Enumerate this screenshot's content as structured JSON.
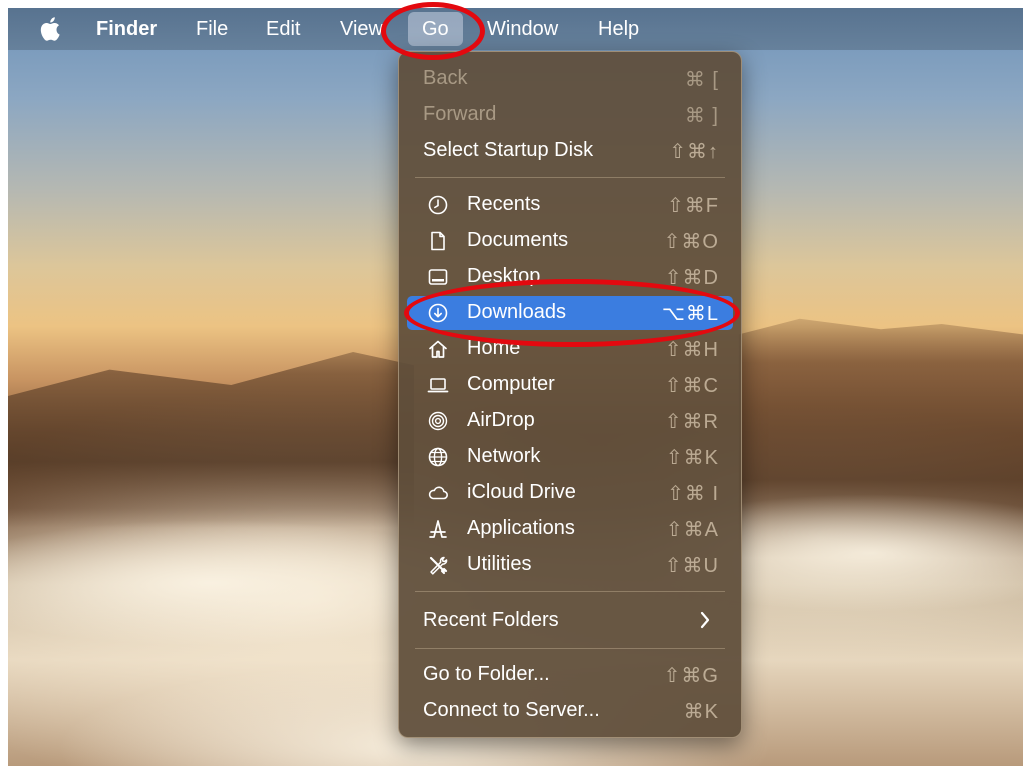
{
  "menubar": {
    "app_name": "Finder",
    "items": [
      "File",
      "Edit",
      "View",
      "Go",
      "Window",
      "Help"
    ]
  },
  "go_menu": {
    "items": [
      {
        "label": "Back",
        "shortcut": "⌘ [",
        "disabled": true
      },
      {
        "label": "Forward",
        "shortcut": "⌘ ]",
        "disabled": true
      },
      {
        "label": "Select Startup Disk",
        "shortcut": "⇧⌘↑"
      },
      {
        "label": "Recents",
        "shortcut": "⇧⌘F",
        "icon": "clock-icon"
      },
      {
        "label": "Documents",
        "shortcut": "⇧⌘O",
        "icon": "document-icon"
      },
      {
        "label": "Desktop",
        "shortcut": "⇧⌘D",
        "icon": "desktop-icon"
      },
      {
        "label": "Downloads",
        "shortcut": "⌥⌘L",
        "icon": "download-icon",
        "highlighted": true
      },
      {
        "label": "Home",
        "shortcut": "⇧⌘H",
        "icon": "home-icon"
      },
      {
        "label": "Computer",
        "shortcut": "⇧⌘C",
        "icon": "laptop-icon"
      },
      {
        "label": "AirDrop",
        "shortcut": "⇧⌘R",
        "icon": "airdrop-icon"
      },
      {
        "label": "Network",
        "shortcut": "⇧⌘K",
        "icon": "globe-icon"
      },
      {
        "label": "iCloud Drive",
        "shortcut": "⇧⌘ I",
        "icon": "cloud-icon"
      },
      {
        "label": "Applications",
        "shortcut": "⇧⌘A",
        "icon": "applications-icon"
      },
      {
        "label": "Utilities",
        "shortcut": "⇧⌘U",
        "icon": "tools-icon"
      },
      {
        "label": "Recent Folders",
        "submenu_indicator": "›"
      },
      {
        "label": "Go to Folder...",
        "shortcut": "⇧⌘G"
      },
      {
        "label": "Connect to Server...",
        "shortcut": "⌘K"
      }
    ]
  },
  "colors": {
    "highlight": "#3b7de0",
    "annotation": "#e3090f"
  }
}
